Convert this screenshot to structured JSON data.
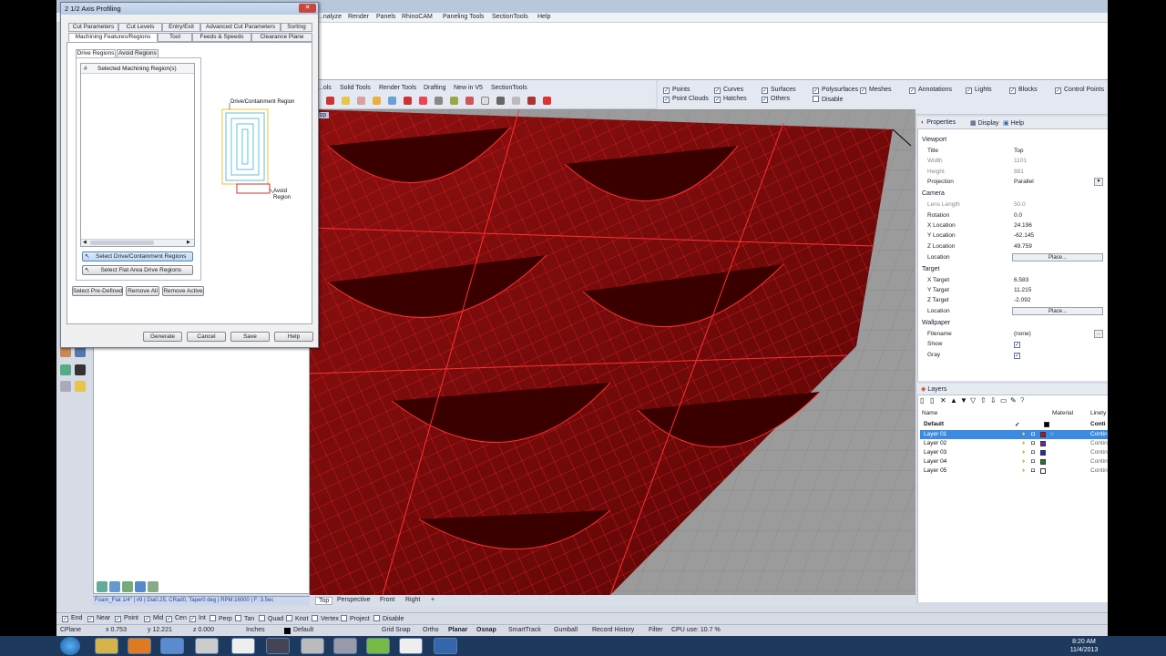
{
  "menubar": {
    "items": [
      "...nalyze",
      "Render",
      "Panels",
      "RhinoCAM",
      "Paneling Tools",
      "SectionTools",
      "Help"
    ]
  },
  "toolbar": {
    "tabs": [
      "...ols",
      "Solid Tools",
      "Render Tools",
      "Drafting",
      "New in V5",
      "SectionTools"
    ]
  },
  "filters": {
    "items": [
      {
        "label": "Points",
        "checked": true
      },
      {
        "label": "Point Clouds",
        "checked": true
      },
      {
        "label": "Curves",
        "checked": true
      },
      {
        "label": "Hatches",
        "checked": true
      },
      {
        "label": "Surfaces",
        "checked": true
      },
      {
        "label": "Others",
        "checked": true
      },
      {
        "label": "Polysurfaces",
        "checked": true
      },
      {
        "label": "Disable",
        "checked": false
      },
      {
        "label": "Meshes",
        "checked": true
      },
      {
        "label": "Annotations",
        "checked": true
      },
      {
        "label": "Lights",
        "checked": true
      },
      {
        "label": "Blocks",
        "checked": true
      },
      {
        "label": "Control Points",
        "checked": true
      }
    ]
  },
  "viewport": {
    "label": "Top",
    "tabs": [
      "Top",
      "Perspective",
      "Front",
      "Right"
    ],
    "add_symbol": "+"
  },
  "command_status": "Foam_Flat 1/4\" | #9 | Dia0.25, CRad0, Taper0 deg | RPM:16000 | F: 3.5ec",
  "properties": {
    "tabs": [
      "Properties",
      "Display",
      "Help"
    ],
    "viewport_section": "Viewport",
    "title_label": "Title",
    "title_value": "Top",
    "width_label": "Width",
    "width_value": "1101",
    "height_label": "Height",
    "height_value": "881",
    "projection_label": "Projection",
    "projection_value": "Parallel",
    "camera_section": "Camera",
    "lens_label": "Lens Length",
    "lens_value": "50.0",
    "rotation_label": "Rotation",
    "rotation_value": "0.0",
    "xloc_label": "X Location",
    "xloc_value": "24.196",
    "yloc_label": "Y Location",
    "yloc_value": "-62.145",
    "zloc_label": "Z Location",
    "zloc_value": "49.759",
    "location_label": "Location",
    "place_label": "Place...",
    "target_section": "Target",
    "xt_label": "X Target",
    "xt_value": "6.583",
    "yt_label": "Y Target",
    "yt_value": "11.215",
    "zt_label": "Z Target",
    "zt_value": "-2.092",
    "tlocation_label": "Location",
    "tplace_label": "Place...",
    "wallpaper_section": "Wallpaper",
    "filename_label": "Filename",
    "filename_value": "(none)",
    "show_label": "Show",
    "gray_label": "Gray"
  },
  "layers": {
    "title": "Layers",
    "col_name": "Name",
    "col_material": "Material",
    "col_linetype": "Linety",
    "rows": [
      {
        "name": "Default",
        "linetype": "Conti",
        "color": "#000000",
        "current": "✓"
      },
      {
        "name": "Layer 01",
        "linetype": "Contin",
        "color": "#c0101a"
      },
      {
        "name": "Layer 02",
        "linetype": "Contin",
        "color": "#7a1fa2"
      },
      {
        "name": "Layer 03",
        "linetype": "Contin",
        "color": "#1a2fc0"
      },
      {
        "name": "Layer 04",
        "linetype": "Contin",
        "color": "#1a7a2a"
      },
      {
        "name": "Layer 05",
        "linetype": "Contin",
        "color": "#ffffff"
      }
    ]
  },
  "osnap": [
    {
      "label": "End",
      "checked": true
    },
    {
      "label": "Near",
      "checked": true
    },
    {
      "label": "Point",
      "checked": true
    },
    {
      "label": "Mid",
      "checked": true
    },
    {
      "label": "Cen",
      "checked": true
    },
    {
      "label": "Int",
      "checked": true
    },
    {
      "label": "Perp",
      "checked": false
    },
    {
      "label": "Tan",
      "checked": false
    },
    {
      "label": "Quad",
      "checked": false
    },
    {
      "label": "Knot",
      "checked": false
    },
    {
      "label": "Vertex",
      "checked": false
    },
    {
      "label": "Project",
      "checked": false
    },
    {
      "label": "Disable",
      "checked": false
    }
  ],
  "statusbar": {
    "cplane": "CPlane",
    "x": "x 0.753",
    "y": "y 12.221",
    "z": "z 0.000",
    "units": "Inches",
    "layer": "Default",
    "grid_snap": "Grid Snap",
    "ortho": "Ortho",
    "planar": "Planar",
    "osnap": "Osnap",
    "smarttrack": "SmartTrack",
    "gumball": "Gumball",
    "record_history": "Record History",
    "filter": "Filter",
    "cpu": "CPU use: 10.7 %"
  },
  "clock": {
    "time": "8:20 AM",
    "date": "11/4/2013"
  },
  "dialog": {
    "title": "2 1/2 Axis Profiling",
    "tabs_row1": [
      "Cut Parameters",
      "Cut Levels",
      "Entry/Exit",
      "Advanced Cut Parameters",
      "Sorting"
    ],
    "tabs_row2": [
      "Machining Features/Regions",
      "Tool",
      "Feeds & Speeds",
      "Clearance Plane"
    ],
    "subtabs": [
      "Drive Regions",
      "Avoid Regions"
    ],
    "list_col_num": "#",
    "list_col_name": "Selected Machining Region(s)",
    "diagram_drive": "Drive/Containment Region",
    "diagram_avoid": "Avoid",
    "diagram_region": "Region",
    "btn_select_drive": "Select Drive/Containment Regions",
    "btn_select_flat": "Select Flat Area Drive Regions",
    "btn_predefined": "Select Pre-Defined",
    "btn_remove_all": "Remove All",
    "btn_remove_active": "Remove Active",
    "btn_generate": "Generate",
    "btn_cancel": "Cancel",
    "btn_save": "Save",
    "btn_help": "Help"
  }
}
